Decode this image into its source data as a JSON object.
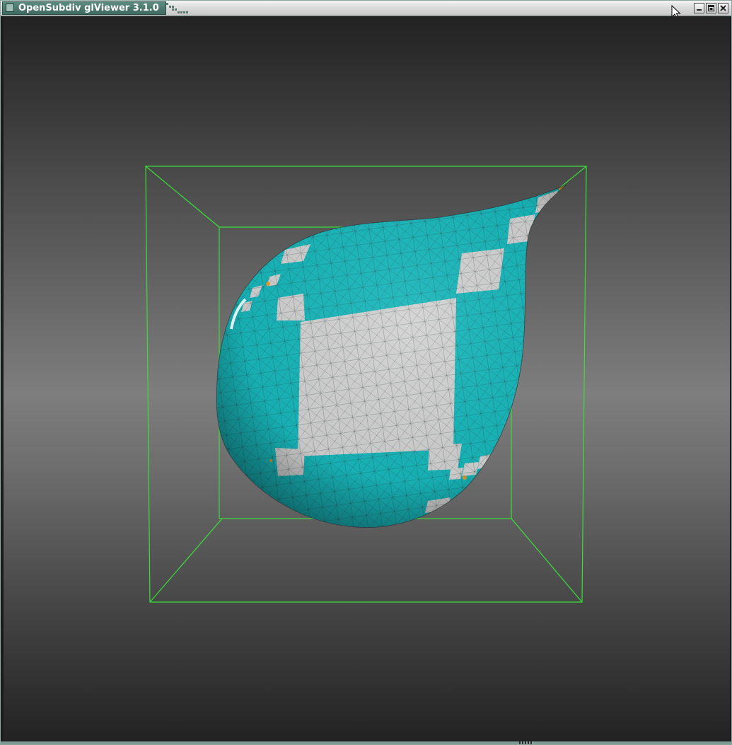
{
  "window": {
    "title": "OpenSubdiv glViewer 3.1.0",
    "app_icon": "app-window-icon",
    "buttons": [
      {
        "name": "minimize-button",
        "icon": "minimize-icon"
      },
      {
        "name": "maximize-button",
        "icon": "maximize-icon"
      },
      {
        "name": "close-button",
        "icon": "close-icon"
      }
    ]
  },
  "scene": {
    "model": "teardrop-subdivision-mesh",
    "bounding_box_color": "#38e038",
    "mesh_colors": {
      "cyan": "#18b8bc",
      "white": "#d2d2d2",
      "wireframe": "#2a3a3a",
      "extraordinary": "#e0a030"
    }
  }
}
